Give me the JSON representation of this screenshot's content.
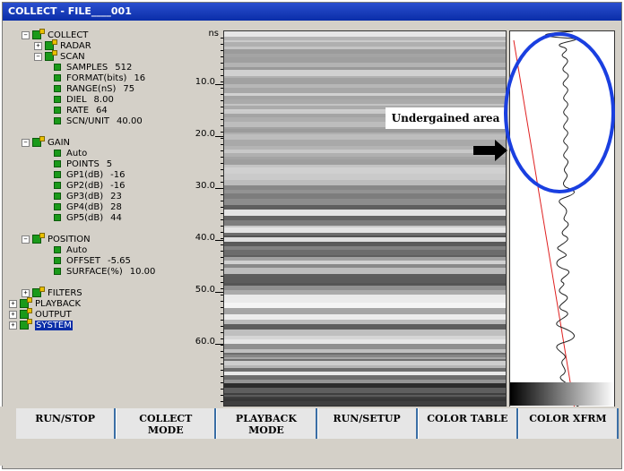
{
  "window": {
    "title": "COLLECT - FILE____001"
  },
  "tree": {
    "collect": "COLLECT",
    "radar": "RADAR",
    "scan": "SCAN",
    "scan_items": [
      {
        "label": "SAMPLES",
        "value": "512"
      },
      {
        "label": "FORMAT(bits)",
        "value": "16"
      },
      {
        "label": "RANGE(nS)",
        "value": "75"
      },
      {
        "label": "DIEL",
        "value": "8.00"
      },
      {
        "label": "RATE",
        "value": "64"
      },
      {
        "label": "SCN/UNIT",
        "value": "40.00"
      }
    ],
    "gain": "GAIN",
    "gain_items": [
      {
        "label": "Auto",
        "value": ""
      },
      {
        "label": "POINTS",
        "value": "5"
      },
      {
        "label": "GP1(dB)",
        "value": "-16"
      },
      {
        "label": "GP2(dB)",
        "value": "-16"
      },
      {
        "label": "GP3(dB)",
        "value": "23"
      },
      {
        "label": "GP4(dB)",
        "value": "28"
      },
      {
        "label": "GP5(dB)",
        "value": "44"
      }
    ],
    "position": "POSITION",
    "position_items": [
      {
        "label": "Auto",
        "value": ""
      },
      {
        "label": "OFFSET",
        "value": "-5.65"
      },
      {
        "label": "SURFACE(%)",
        "value": "10.00"
      }
    ],
    "filters": "FILTERS",
    "playback": "PLAYBACK",
    "output": "OUTPUT",
    "system": "SYSTEM"
  },
  "axis": {
    "unit": "ns",
    "ticks": [
      "10.0",
      "20.0",
      "30.0",
      "40.0",
      "50.0",
      "60.0"
    ]
  },
  "annotation": {
    "text": "Undergained area"
  },
  "colors": {
    "title_bar": "#0a2da8",
    "ellipse": "#1a3fe0",
    "trace_line": "#e02020",
    "tree_icon": "#1a9a1a"
  },
  "function_keys": [
    {
      "line1": "RUN/STOP",
      "line2": ""
    },
    {
      "line1": "COLLECT",
      "line2": "MODE"
    },
    {
      "line1": "PLAYBACK",
      "line2": "MODE"
    },
    {
      "line1": "RUN/SETUP",
      "line2": ""
    },
    {
      "line1": "COLOR TABLE",
      "line2": ""
    },
    {
      "line1": "COLOR XFRM",
      "line2": ""
    }
  ]
}
